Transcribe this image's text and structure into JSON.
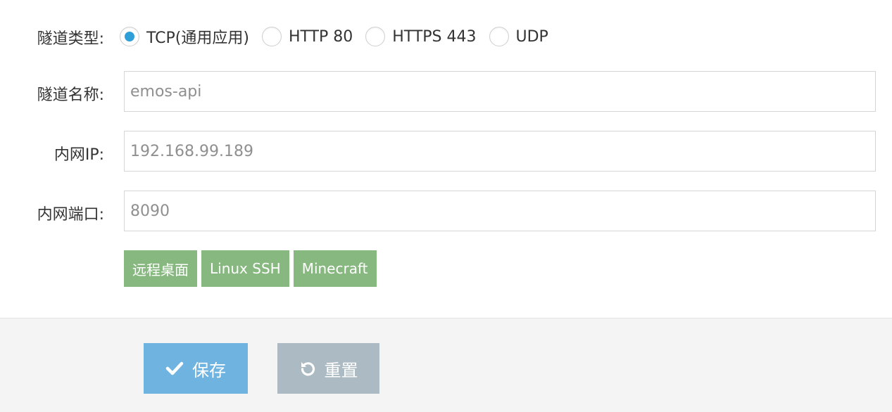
{
  "form": {
    "tunnel_type": {
      "label": "隧道类型:",
      "options": [
        {
          "label": "TCP(通用应用)",
          "checked": true
        },
        {
          "label": "HTTP 80",
          "checked": false
        },
        {
          "label": "HTTPS 443",
          "checked": false
        },
        {
          "label": "UDP",
          "checked": false
        }
      ]
    },
    "tunnel_name": {
      "label": "隧道名称:",
      "placeholder": "emos-api"
    },
    "local_ip": {
      "label": "内网IP:",
      "placeholder": "192.168.99.189"
    },
    "local_port": {
      "label": "内网端口:",
      "placeholder": "8090"
    },
    "presets": [
      {
        "label": "远程桌面"
      },
      {
        "label": "Linux SSH"
      },
      {
        "label": "Minecraft"
      }
    ]
  },
  "footer": {
    "save_label": "保存",
    "reset_label": "重置"
  },
  "colors": {
    "radio_checked": "#2f9fd8",
    "preset_bg": "#87b87f",
    "save_bg": "#6fb3e0",
    "reset_bg": "#abbac3",
    "footer_bg": "#f4f4f4"
  },
  "icons": {
    "save": "check-icon",
    "reset": "undo-icon"
  }
}
